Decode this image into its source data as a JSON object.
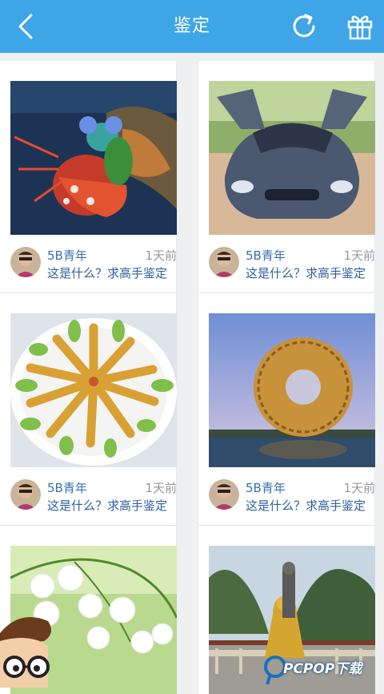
{
  "header": {
    "title": "鉴定",
    "back_icon": "back-chevron-icon",
    "refresh_icon": "refresh-icon",
    "gift_icon": "gift-icon",
    "bar_color": "#3ea6e6"
  },
  "posts": [
    {
      "image": "mantis-shrimp-photo",
      "user": "5B青年",
      "time": "1天前",
      "question": "这是什么？求高手鉴定"
    },
    {
      "image": "gullwing-car-photo",
      "user": "5B青年",
      "time": "1天前",
      "question": "这是什么？求高手鉴定"
    },
    {
      "image": "fried-dish-photo",
      "user": "5B青年",
      "time": "1天前",
      "question": "这是什么？求高手鉴定"
    },
    {
      "image": "ring-building-photo",
      "user": "5B青年",
      "time": "1天前",
      "question": "这是什么？求高手鉴定"
    },
    {
      "image": "lily-of-valley-photo",
      "user": "",
      "time": "",
      "question": ""
    },
    {
      "image": "dragon-statue-photo",
      "user": "",
      "time": "",
      "question": ""
    }
  ],
  "watermark": {
    "text": "PCPOP下载"
  }
}
